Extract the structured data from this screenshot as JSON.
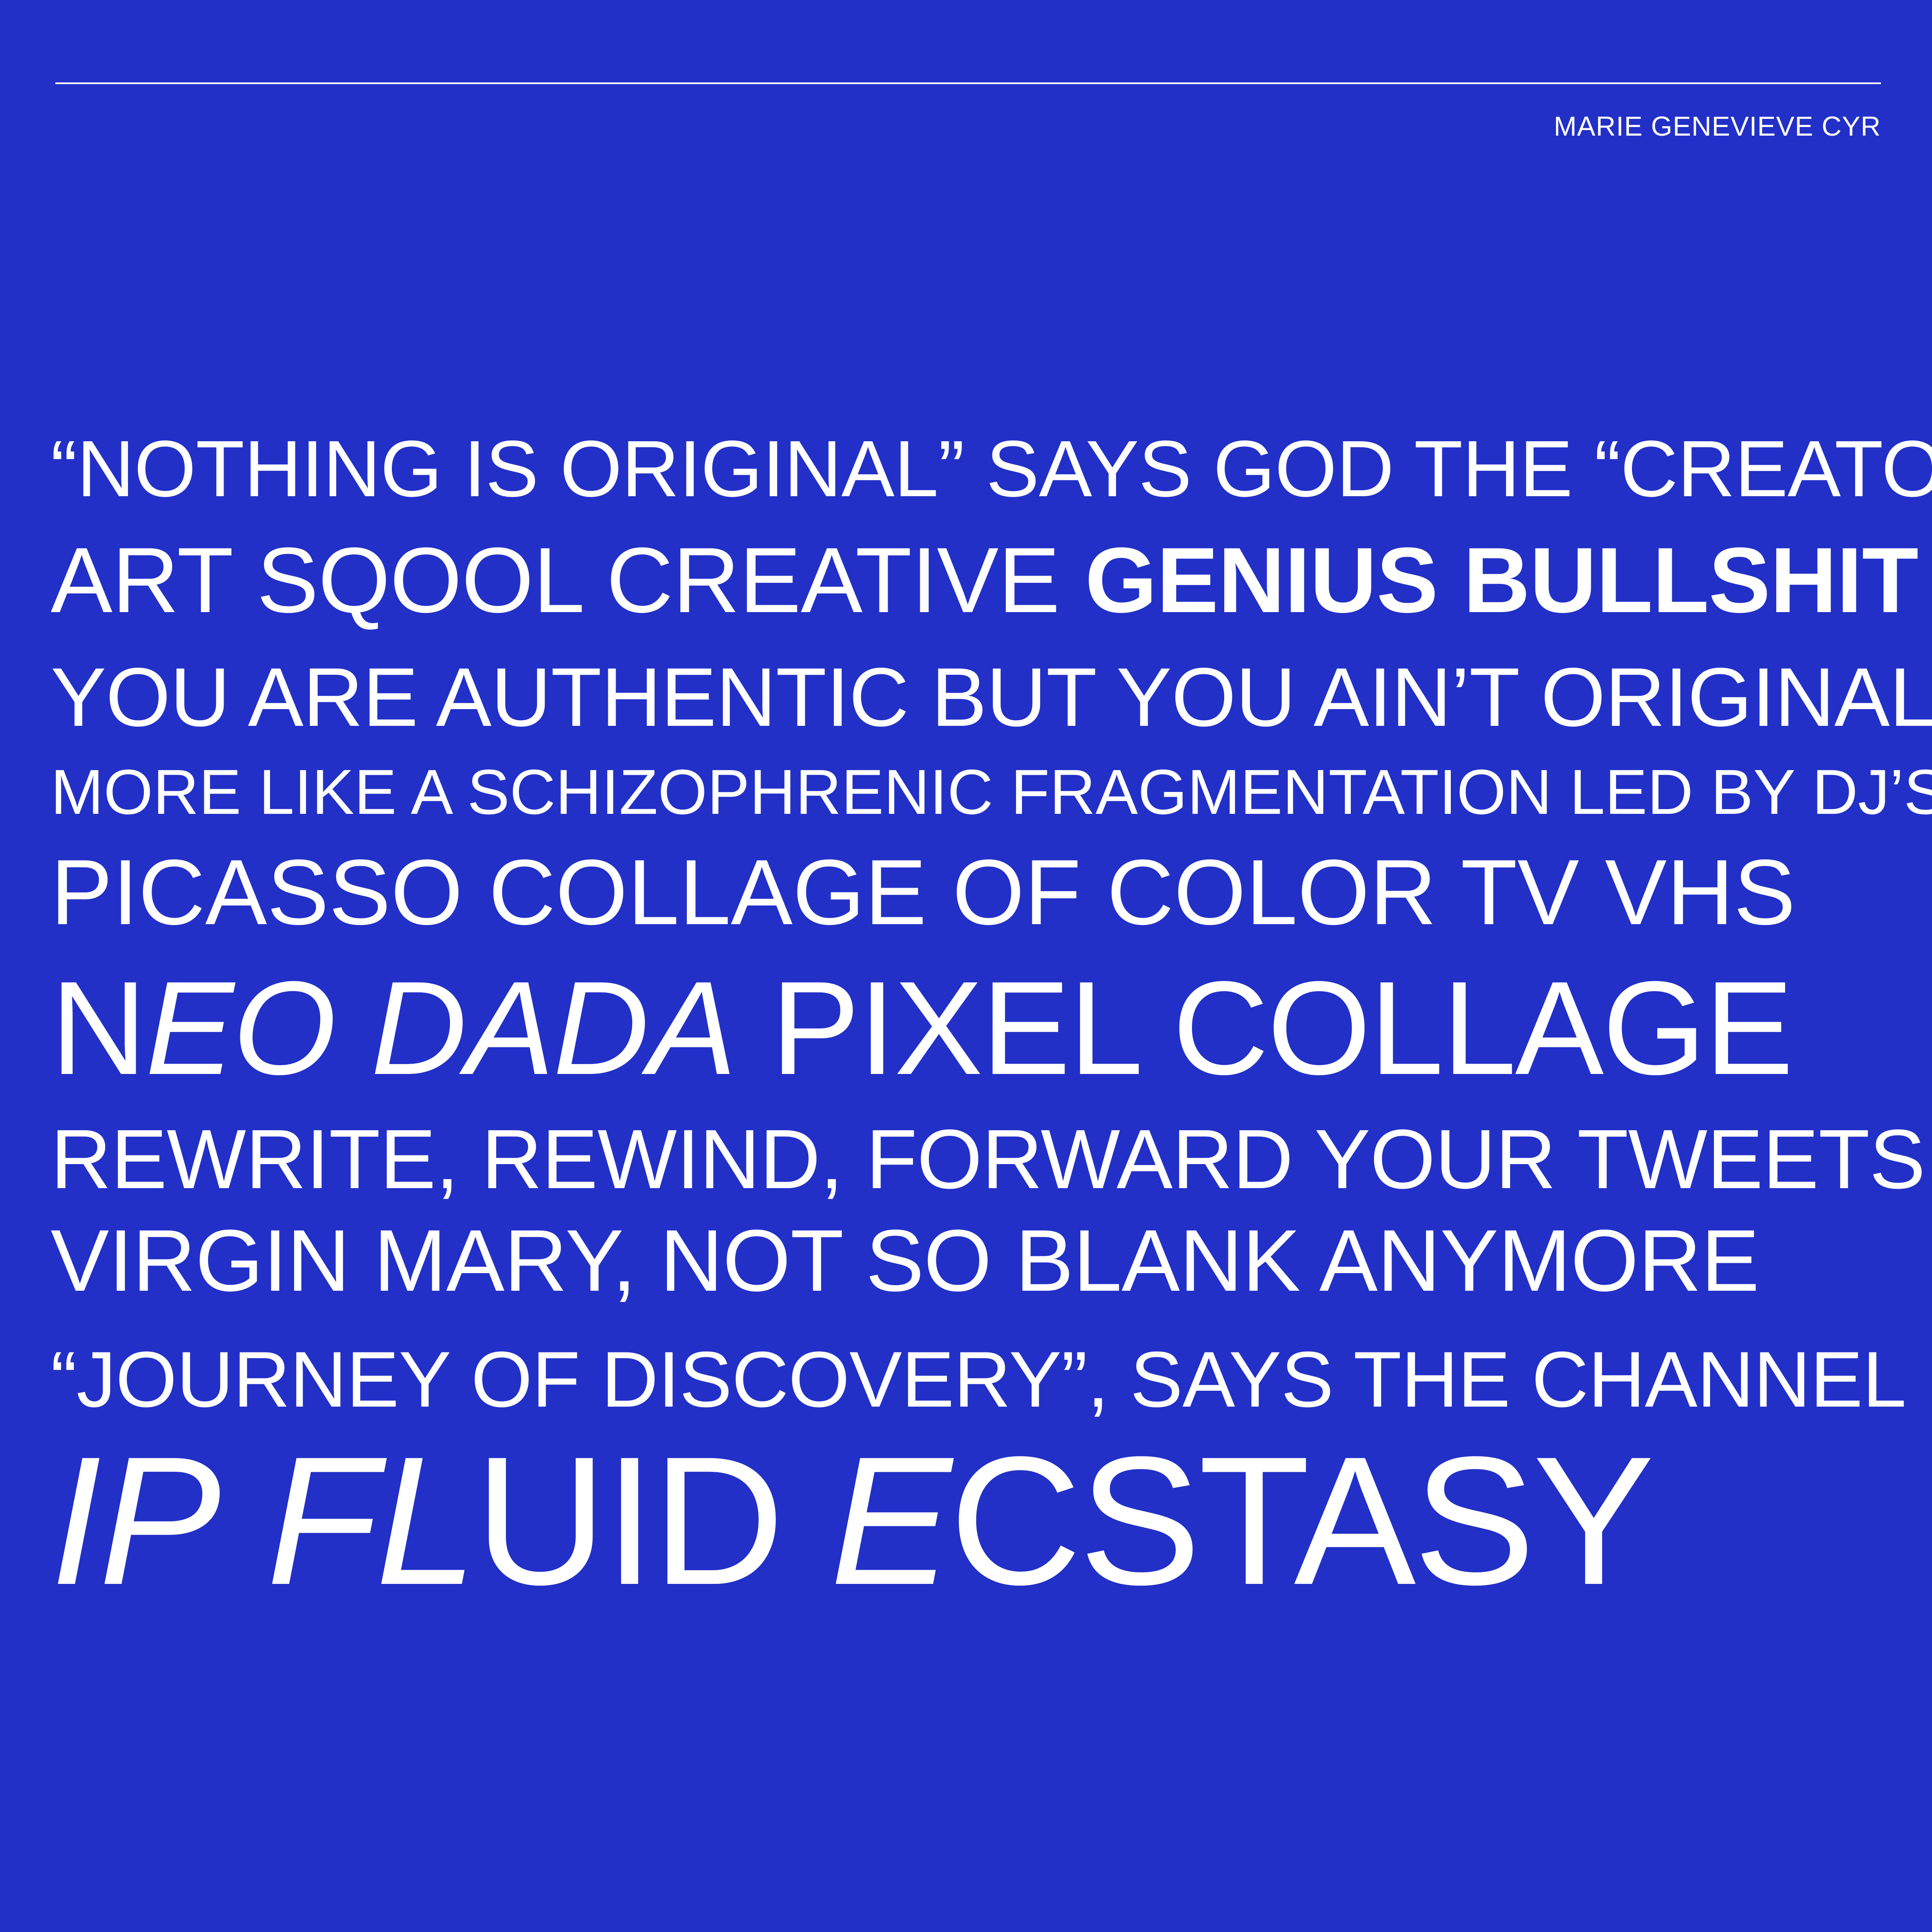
{
  "colors": {
    "background": "#2230c8",
    "text": "#ffffff"
  },
  "author": "MARIE GENEVIEVE CYR",
  "lines": [
    {
      "segments": [
        {
          "text": "“NOTHING IS ORIGINAL” SAYS GOD THE “CREATOR”",
          "style": "regular"
        }
      ]
    },
    {
      "segments": [
        {
          "text": "ART SQOOL CREATIVE ",
          "style": "regular"
        },
        {
          "text": "GENIUS BULLSHIT",
          "style": "bold"
        }
      ]
    },
    {
      "segments": [
        {
          "text": "YOU ARE AUTHENTIC BUT YOU AIN’T ORIGINAL",
          "style": "regular"
        }
      ]
    },
    {
      "segments": [
        {
          "text": "MORE LIKE A SCHIZOPHRENIC FRAGMENTATION LED BY DJ’S",
          "style": "regular"
        }
      ]
    },
    {
      "segments": [
        {
          "text": "PICASSO COLLAGE OF COLOR TV VHS",
          "style": "regular"
        }
      ]
    },
    {
      "segments": [
        {
          "text": "N",
          "style": "regular"
        },
        {
          "text": "EO",
          "style": "italic"
        },
        {
          "text": " DADA",
          "style": "italic"
        },
        {
          "text": " PIXEL COLLAGE",
          "style": "regular"
        }
      ]
    },
    {
      "segments": [
        {
          "text": "REWRITE, REWIND, FORWARD YOUR TWEETS",
          "style": "regular"
        }
      ]
    },
    {
      "segments": [
        {
          "text": "VIRGIN MARY, NOT SO BLANK ANYMORE",
          "style": "regular"
        }
      ]
    },
    {
      "segments": [
        {
          "text": "“JOURNEY OF DISCOVERY”, SAYS THE CHANNEL",
          "style": "regular"
        }
      ]
    },
    {
      "segments": [
        {
          "text": "IP",
          "style": "italic"
        },
        {
          "text": " ",
          "style": "regular"
        },
        {
          "text": "FL",
          "style": "italic"
        },
        {
          "text": "UID ",
          "style": "regular"
        },
        {
          "text": "E",
          "style": "italic"
        },
        {
          "text": "CSTASY",
          "style": "regular"
        }
      ]
    }
  ]
}
